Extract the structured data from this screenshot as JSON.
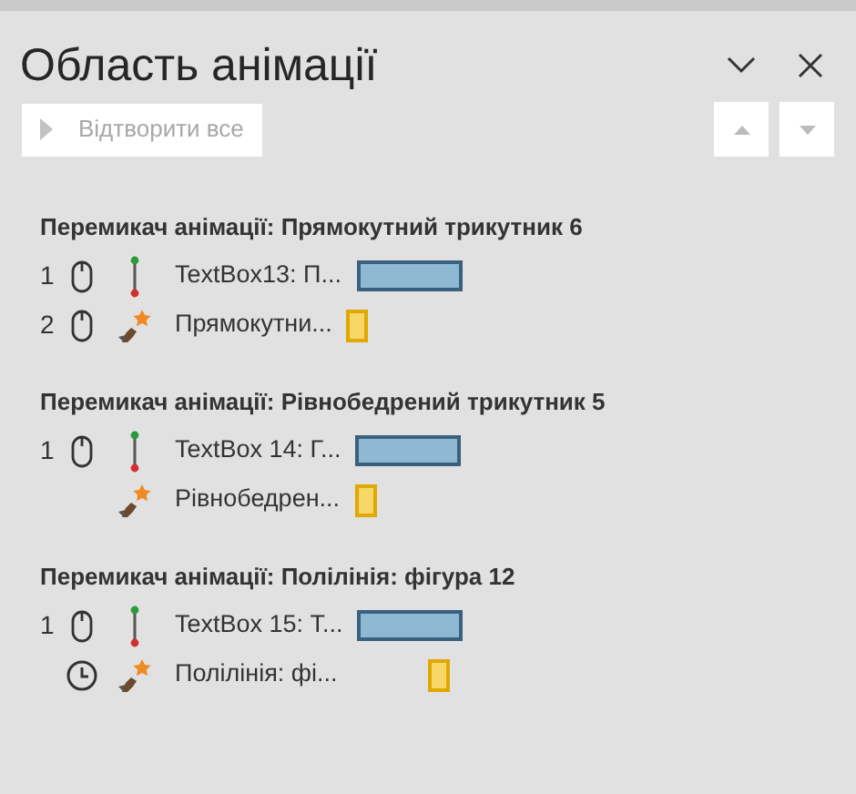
{
  "pane": {
    "title": "Область анімації",
    "play_button": "Відтворити все"
  },
  "groups": [
    {
      "heading": "Перемикач анімації: Прямокутний трикутник 6",
      "items": [
        {
          "number": "1",
          "trigger": {
            "kind": "click"
          },
          "effect": {
            "kind": "line"
          },
          "label": "TextBox13: П...",
          "bar": {
            "kind": "wide"
          }
        },
        {
          "number": "2",
          "trigger": {
            "kind": "click"
          },
          "effect": {
            "kind": "star"
          },
          "label": "Прямокутни...",
          "bar": {
            "kind": "short"
          }
        }
      ]
    },
    {
      "heading": "Перемикач анімації: Рівнобедрений трикутник 5",
      "items": [
        {
          "number": "1",
          "trigger": {
            "kind": "click"
          },
          "effect": {
            "kind": "line"
          },
          "label": "TextBox 14: Г...",
          "bar": {
            "kind": "wide"
          }
        },
        {
          "effect": {
            "kind": "star"
          },
          "label": "Рівнобедрен...",
          "bar": {
            "kind": "short"
          }
        }
      ]
    },
    {
      "heading": "Перемикач анімації: Полілінія: фігура 12",
      "items": [
        {
          "number": "1",
          "trigger": {
            "kind": "click"
          },
          "effect": {
            "kind": "line"
          },
          "label": "TextBox 15: Т...",
          "bar": {
            "kind": "wide"
          }
        },
        {
          "trigger": {
            "kind": "after"
          },
          "effect": {
            "kind": "star"
          },
          "label": "Полілінія: фі...",
          "bar": {
            "kind": "delayed"
          }
        }
      ]
    }
  ]
}
